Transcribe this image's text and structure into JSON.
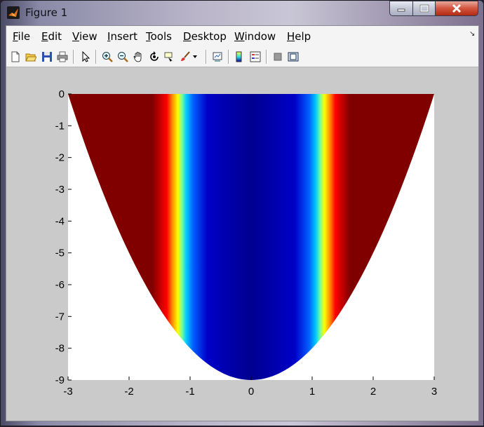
{
  "window": {
    "title": "Figure 1"
  },
  "menu": [
    {
      "id": "file",
      "pre": "",
      "ul": "F",
      "post": "ile"
    },
    {
      "id": "edit",
      "pre": "",
      "ul": "E",
      "post": "dit"
    },
    {
      "id": "view",
      "pre": "",
      "ul": "V",
      "post": "iew"
    },
    {
      "id": "insert",
      "pre": "",
      "ul": "I",
      "post": "nsert"
    },
    {
      "id": "tools",
      "pre": "",
      "ul": "T",
      "post": "ools"
    },
    {
      "id": "desktop",
      "pre": "",
      "ul": "D",
      "post": "esktop"
    },
    {
      "id": "window",
      "pre": "",
      "ul": "W",
      "post": "indow"
    },
    {
      "id": "help",
      "pre": "",
      "ul": "H",
      "post": "elp"
    }
  ],
  "toolbar_icons": [
    "new-figure-icon",
    "open-file-icon",
    "save-icon",
    "print-icon",
    "edit-plot-arrow-icon",
    "zoom-in-icon",
    "zoom-out-icon",
    "pan-hand-icon",
    "rotate-3d-icon",
    "data-cursor-icon",
    "brush-icon",
    "brush-dropdown-icon",
    "link-plot-icon",
    "colorbar-icon",
    "legend-icon",
    "hide-plot-tools-icon",
    "show-plot-tools-icon"
  ],
  "colors": {
    "dark_red": "#800000",
    "dark_blue": "#000090",
    "title_close": "#c8412b"
  },
  "chart_data": {
    "type": "heatmap",
    "title": "",
    "xlabel": "",
    "ylabel": "",
    "xlim": [
      -3,
      3
    ],
    "ylim": [
      -9,
      0
    ],
    "x_ticks": [
      "-3",
      "-2",
      "-1",
      "0",
      "1",
      "2",
      "3"
    ],
    "y_ticks": [
      "0",
      "-1",
      "-2",
      "-3",
      "-4",
      "-5",
      "-6",
      "-7",
      "-8",
      "-9"
    ],
    "x_tick_values": [
      -3,
      -2,
      -1,
      0,
      1,
      2,
      3
    ],
    "y_tick_values": [
      0,
      -1,
      -2,
      -3,
      -4,
      -5,
      -6,
      -7,
      -8,
      -9
    ],
    "region_lower_boundary": "y = -9 + x^2",
    "colormap": "jet",
    "color_by": "|x|",
    "color_profile": [
      {
        "abs_x": 0.0,
        "color": "#000090"
      },
      {
        "abs_x": 0.72,
        "color": "#0000c8"
      },
      {
        "abs_x": 0.95,
        "color": "#0060ff"
      },
      {
        "abs_x": 1.06,
        "color": "#00c8ff"
      },
      {
        "abs_x": 1.13,
        "color": "#70ffa0"
      },
      {
        "abs_x": 1.2,
        "color": "#ffff00"
      },
      {
        "abs_x": 1.3,
        "color": "#ff8000"
      },
      {
        "abs_x": 1.38,
        "color": "#ff0000"
      },
      {
        "abs_x": 1.62,
        "color": "#800000"
      },
      {
        "abs_x": 3.0,
        "color": "#800000"
      }
    ]
  }
}
